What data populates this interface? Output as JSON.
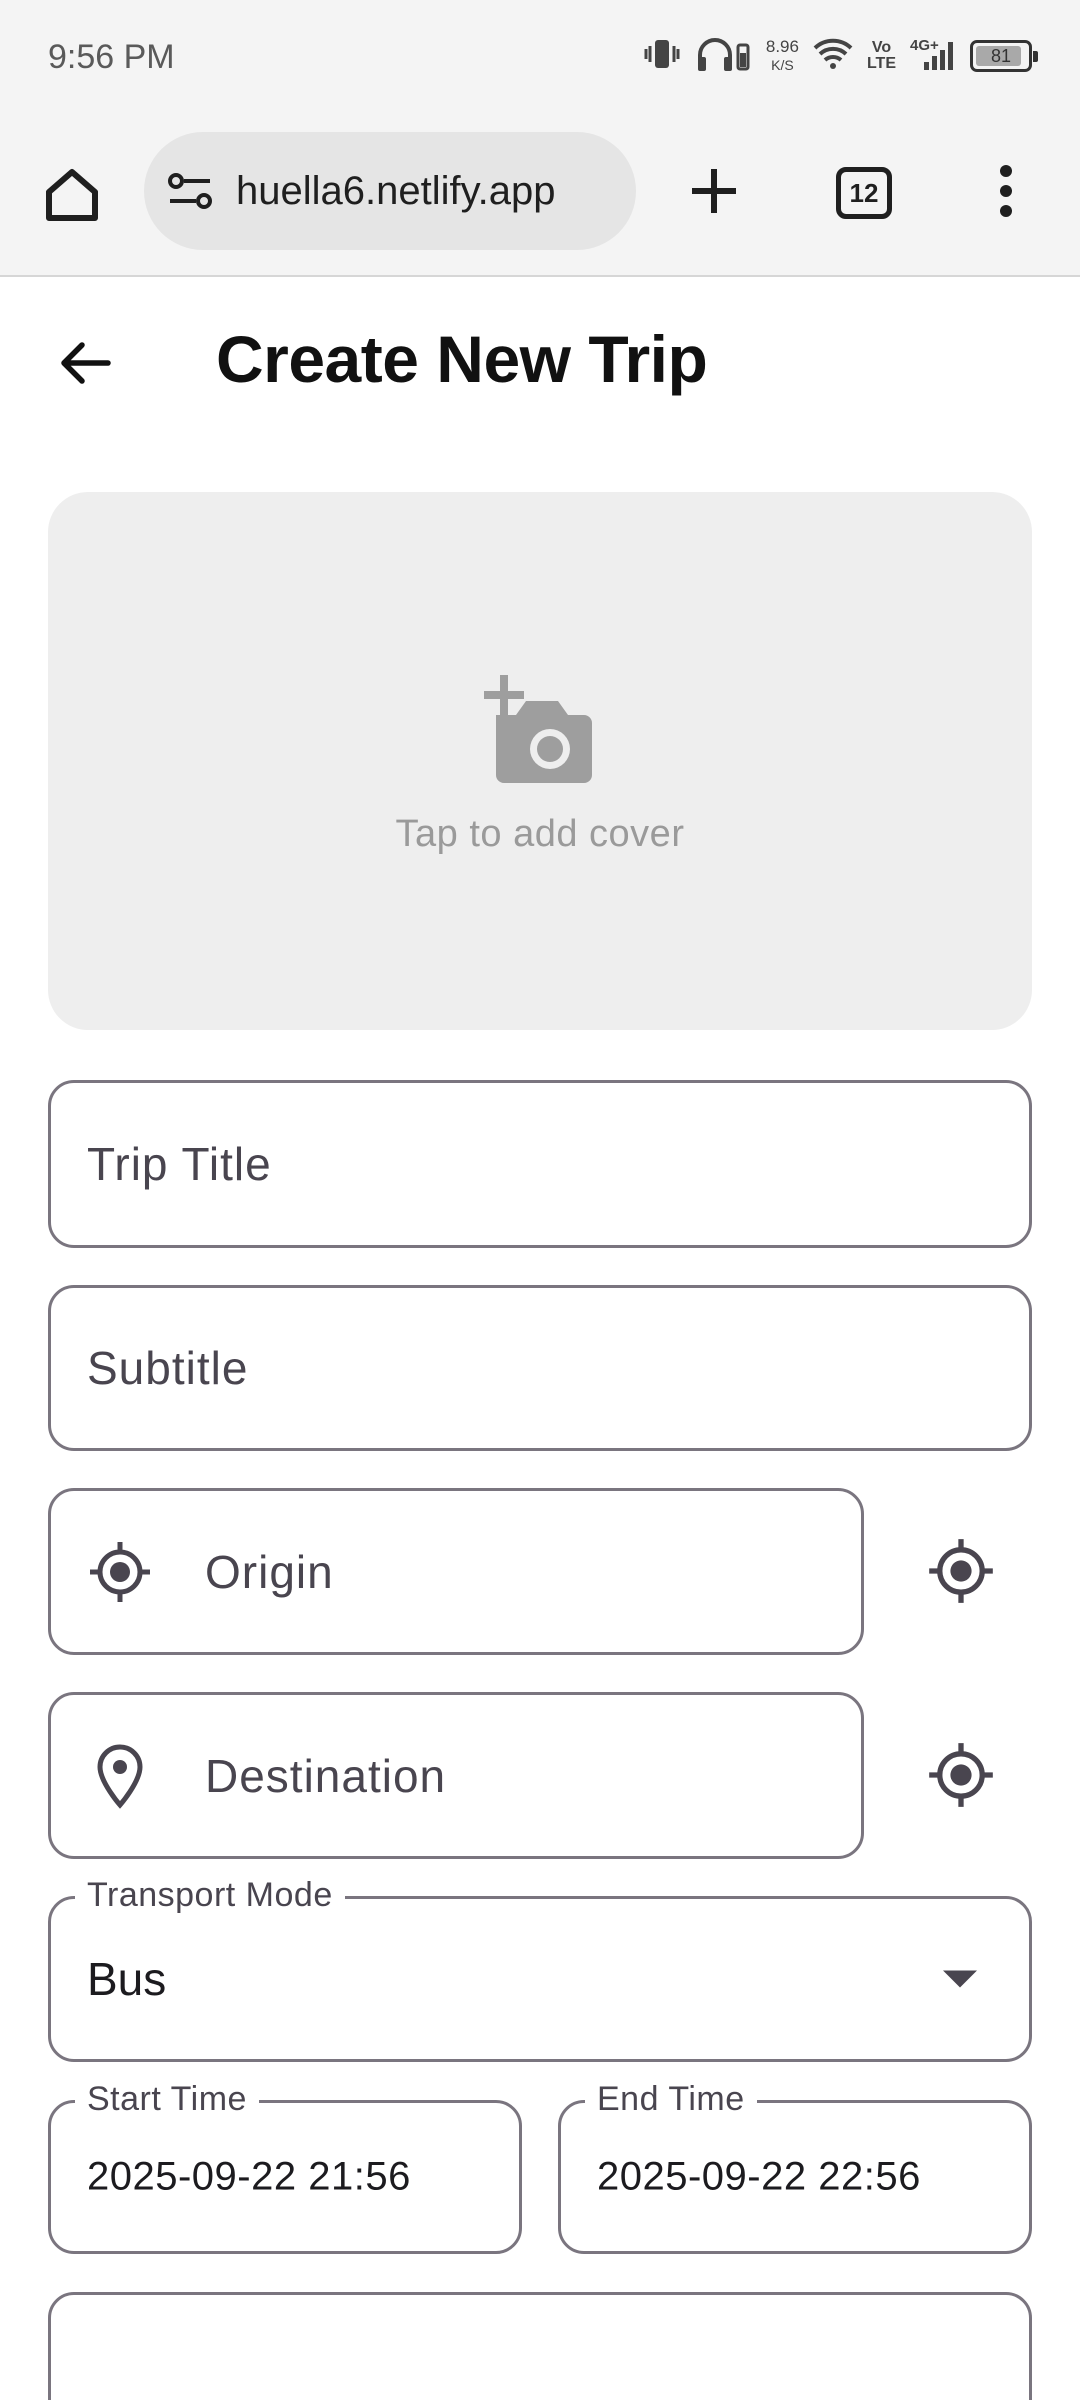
{
  "status_bar": {
    "time": "9:56 PM",
    "net_speed_value": "8.96",
    "net_speed_unit": "K/S",
    "volte_top": "Vo",
    "volte_bottom": "LTE",
    "network": "4G+",
    "battery_level": "81"
  },
  "browser": {
    "url": "huella6.netlify.app",
    "tab_count": "12"
  },
  "app_bar": {
    "title": "Create New Trip"
  },
  "cover": {
    "label": "Tap to add cover"
  },
  "form": {
    "trip_title_placeholder": "Trip Title",
    "subtitle_placeholder": "Subtitle",
    "origin_placeholder": "Origin",
    "destination_placeholder": "Destination",
    "transport_label": "Transport Mode",
    "transport_value": "Bus",
    "start_label": "Start Time",
    "start_value": "2025-09-22 21:56",
    "end_label": "End Time",
    "end_value": "2025-09-22 22:56"
  },
  "colors": {
    "field_border": "#7a757f",
    "cover_bg": "#eeeeee",
    "icon_dark": "#49454f"
  }
}
